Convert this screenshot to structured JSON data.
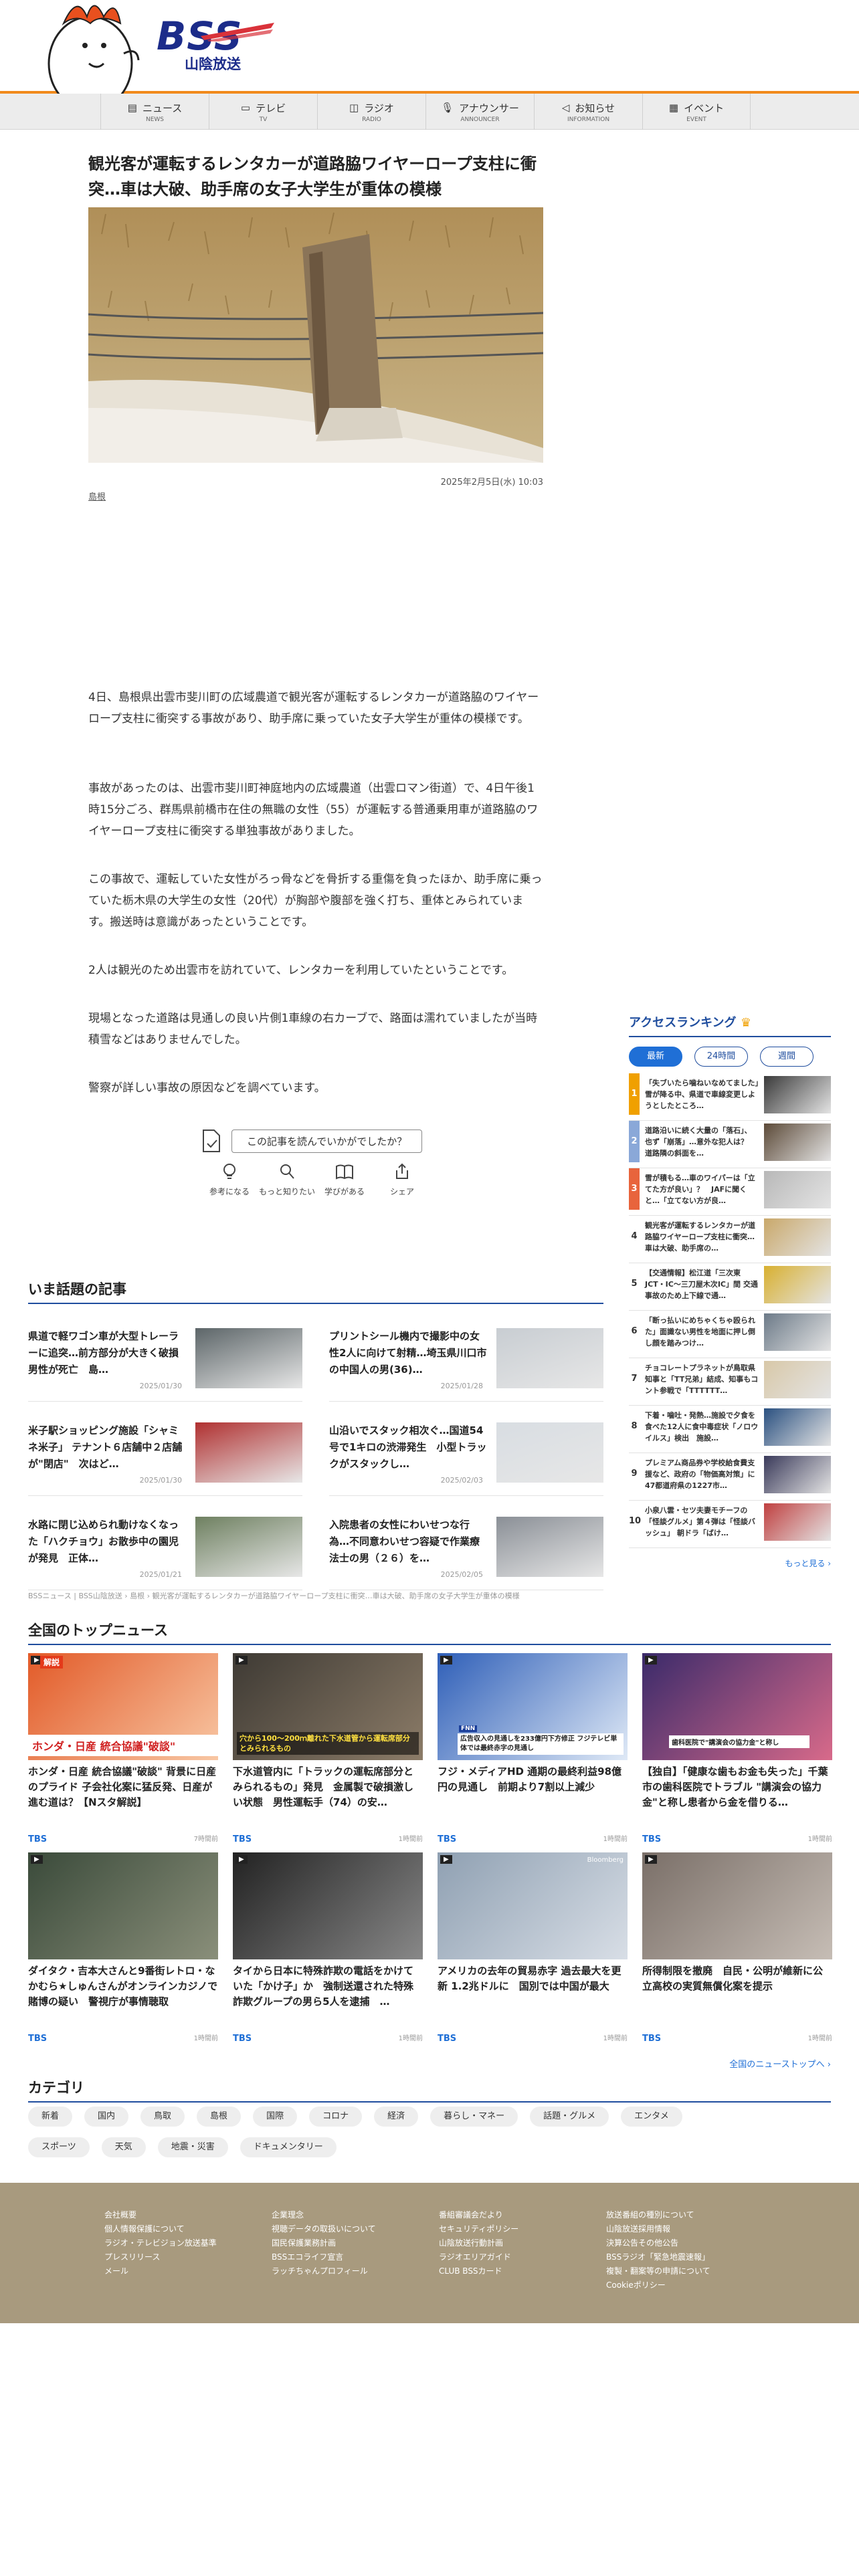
{
  "header": {
    "logo_text": "BSS",
    "logo_sub": "山陰放送"
  },
  "nav": [
    {
      "label": "ニュース",
      "en": "NEWS",
      "icon": "newspaper-icon"
    },
    {
      "label": "テレビ",
      "en": "TV",
      "icon": "tv-icon"
    },
    {
      "label": "ラジオ",
      "en": "RADIO",
      "icon": "radio-icon"
    },
    {
      "label": "アナウンサー",
      "en": "ANNOUNCER",
      "icon": "microphone-icon"
    },
    {
      "label": "お知らせ",
      "en": "INFORMATION",
      "icon": "megaphone-icon"
    },
    {
      "label": "イベント",
      "en": "EVENT",
      "icon": "calendar-icon"
    }
  ],
  "article": {
    "title": "観光客が運転するレンタカーが道路脇ワイヤーロープ支柱に衝突…車は大破、助手席の女子大学生が重体の模様",
    "date": "2025年2月5日(水) 10:03",
    "tag": "島根",
    "paragraphs": [
      "4日、島根県出雲市斐川町の広域農道で観光客が運転するレンタカーが道路脇のワイヤーロープ支柱に衝突する事故があり、助手席に乗っていた女子大学生が重体の模様です。",
      "事故があったのは、出雲市斐川町神庭地内の広域農道（出雲ロマン街道）で、4日午後1時15分ごろ、群馬県前橋市在住の無職の女性（55）が運転する普通乗用車が道路脇のワイヤーロープ支柱に衝突する単独事故がありました。",
      "この事故で、運転していた女性がろっ骨などを骨折する重傷を負ったほか、助手席に乗っていた栃木県の大学生の女性（20代）が胸部や腹部を強く打ち、重体とみられています。搬送時は意識があったということです。",
      "2人は観光のため出雲市を訪れていて、レンタカーを利用していたということです。",
      "現場となった道路は見通しの良い片側1車線の右カーブで、路面は濡れていましたが当時積雪などはありませんでした。",
      "警察が詳しい事故の原因などを調べています。"
    ]
  },
  "feedback": {
    "question": "この記事を読んでいかがでしたか？",
    "buttons": [
      {
        "label": "参考になる",
        "icon": "lightbulb-icon"
      },
      {
        "label": "もっと知りたい",
        "icon": "magnifier-icon"
      },
      {
        "label": "学びがある",
        "icon": "book-icon"
      },
      {
        "label": "シェア",
        "icon": "share-icon"
      }
    ]
  },
  "trending": {
    "heading": "いま話題の記事",
    "items": [
      {
        "title": "県道で軽ワゴン車が大型トレーラーに追突…前方部分が大きく破損　男性が死亡　島…",
        "date": "2025/01/30"
      },
      {
        "title": "プリントシール機内で撮影中の女性2人に向けて射精…埼玉県川口市の中国人の男(36)…",
        "date": "2025/01/28"
      },
      {
        "title": "米子駅ショッピング施設「シャミネ米子」 テナント６店舗中２店舗が\"閉店\"　次はど…",
        "date": "2025/01/30"
      },
      {
        "title": "山沿いでスタック相次ぐ…国道54号で1キロの渋滞発生　小型トラックがスタックし…",
        "date": "2025/02/03"
      },
      {
        "title": "水路に閉じ込められ動けなくなった「ハクチョウ」お散歩中の園児が発見　正体…",
        "date": "2025/01/21"
      },
      {
        "title": "入院患者の女性にわいせつな行為…不同意わいせつ容疑で作業療法士の男（２６）を…",
        "date": "2025/02/05"
      }
    ]
  },
  "breadcrumb": "BSSニュース | BSS山陰放送 › 島根 › 観光客が運転するレンタカーが道路脇ワイヤーロープ支柱に衝突…車は大破、助手席の女子大学生が重体の模様",
  "ranking": {
    "heading": "アクセスランキング",
    "tabs": [
      "最新",
      "24時間",
      "週間"
    ],
    "items": [
      {
        "num": "1",
        "title": "「失ブいたら噛ねいなめてました」雪が降る中、県道で車線変更しようとしたところ…",
        "color": "#f0a000"
      },
      {
        "num": "2",
        "title": "道路沿いに続く大量の「落石」、也ず「崩落」…意外な犯人は？　道路隣の斜面を…",
        "color": "#8aa8d8"
      },
      {
        "num": "3",
        "title": "雪が積もる…車のワイパーは「立てた方が良い」？　JAFに聞くと…「立てない方が良…",
        "color": "#e8643c"
      },
      {
        "num": "4",
        "title": "観光客が運転するレンタカーが道路脇ワイヤーロープ支柱に衝突…車は大破、助手席の…",
        "color": ""
      },
      {
        "num": "5",
        "title": "【交通情報】松江道「三次東JCT・IC〜三刀屋木次IC」間 交通事故のため上下線で通…",
        "color": ""
      },
      {
        "num": "6",
        "title": "「断っ払いにめちゃくちゃ殴られた」面識ない男性を地面に押し倒し顔を踏みつけ…",
        "color": ""
      },
      {
        "num": "7",
        "title": "チョコレートプラネットが鳥取県知事と「TT兄弟」結成、知事もコント参戦で「TTTTTT…",
        "color": ""
      },
      {
        "num": "8",
        "title": "下着・噛吐・発熱…施設で夕食を食べた12人に食中毒症状「ノロウイルス」検出　施設…",
        "color": ""
      },
      {
        "num": "9",
        "title": "プレミアム商品券や学校給食費支援など、政府の「物価高対策」に47都道府県の1227市…",
        "color": ""
      },
      {
        "num": "10",
        "title": "小泉八雲・セツ夫妻モチーフの「怪談グルメ」第４弾は「怪談バッシュ」 朝ドラ「ばけ…",
        "color": ""
      }
    ],
    "more": "もっと見る"
  },
  "national": {
    "heading": "全国のトップニュース",
    "items": [
      {
        "title": "ホンダ・日産 統合協議\"破談\" 背景に日産のプライド 子会社化案に猛反発、日産が進む道は？【Nスタ解説】",
        "source": "TBS",
        "time": "7時間前"
      },
      {
        "title": "下水道管内に「トラックの運転席部分とみられるもの」発見　金属製で破損激しい状態　男性運転手（74）の安…",
        "source": "TBS",
        "time": "1時間前"
      },
      {
        "title": "フジ・メディアHD 通期の最終利益98億円の見通し　前期より7割以上減少",
        "source": "TBS",
        "time": "1時間前"
      },
      {
        "title": "【独自】「健康な歯もお金も失った」千葉市の歯科医院でトラブル \"講演会の協力金\"と称し患者から金を借りる…",
        "source": "TBS",
        "time": "1時間前"
      },
      {
        "title": "ダイタク・吉本大さんと9番街レトロ・なかむら★しゅんさんがオンラインカジノで賭博の疑い　警視庁が事情聴取",
        "source": "TBS",
        "time": "1時間前"
      },
      {
        "title": "タイから日本に特殊詐欺の電話をかけていた「かけ子」か　強制送還された特殊詐欺グループの男ら5人を逮捕　…",
        "source": "TBS",
        "time": "1時間前"
      },
      {
        "title": "アメリカの去年の貿易赤字 過去最大を更新 1.2兆ドルに　国別では中国が最大",
        "source": "TBS",
        "time": "1時間前"
      },
      {
        "title": "所得制限を撤廃　自民・公明が維新に公立高校の実質無償化案を提示",
        "source": "TBS",
        "time": "1時間前"
      }
    ],
    "img_texts": [
      "解説",
      "ホンダ・日産 統合協議\"破談\"",
      "穴から100〜200ｍ離れた下水道管から運転席部分とみられるもの",
      "広告収入の見通しを233億円下方修正 フジテレビ単体では最終赤字の見通し",
      "FNN",
      "歯科医院で\"講演会の協力金\"と称し",
      "Bloomberg"
    ],
    "more": "全国のニューストップへ"
  },
  "categories": {
    "heading": "カテゴリ",
    "row1": [
      "新着",
      "国内",
      "鳥取",
      "島根",
      "国際",
      "コロナ",
      "経済",
      "暮らし・マネー",
      "話題・グルメ",
      "エンタメ"
    ],
    "row2": [
      "スポーツ",
      "天気",
      "地震・災害",
      "ドキュメンタリー"
    ]
  },
  "footer": {
    "col1": [
      "会社概要",
      "個人情報保護について",
      "ラジオ・テレビジョン放送基準",
      "プレスリリース",
      "メール"
    ],
    "col2": [
      "企業理念",
      "視聴データの取扱いについて",
      "国民保護業務計画",
      "BSSエコライフ宣言",
      "ラッチちゃんプロフィール"
    ],
    "col3": [
      "番組審議会だより",
      "セキュリティポリシー",
      "山陰放送行動計画",
      "ラジオエリアガイド",
      "CLUB BSSカード"
    ],
    "col4": [
      "放送番組の種別について",
      "山陰放送採用情報",
      "決算公告その他公告",
      "BSSラジオ「緊急地震速報」",
      "複製・翻案等の申請について",
      "Cookieポリシー"
    ]
  },
  "colors": {
    "accent": "#1f4d9e",
    "orange": "#f18a1c",
    "link": "#1f6fd6",
    "footer": "#a89a7e"
  }
}
